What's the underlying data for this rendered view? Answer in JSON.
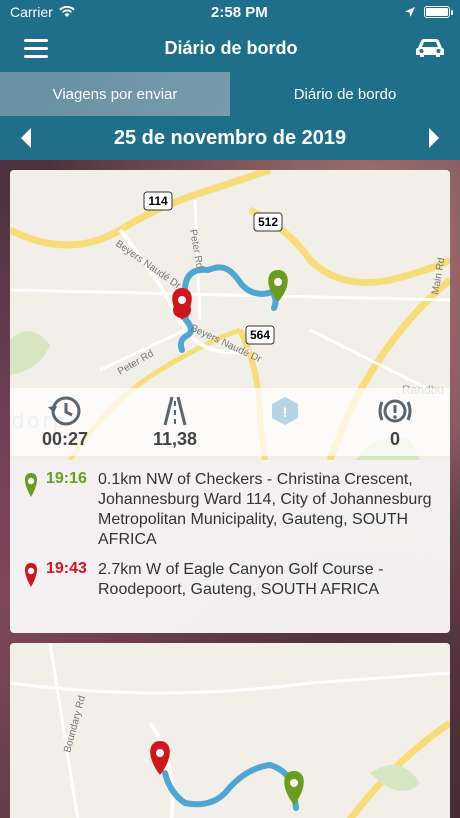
{
  "status_bar": {
    "carrier": "Carrier",
    "time": "2:58 PM"
  },
  "nav": {
    "title": "Diário de bordo"
  },
  "tabs": [
    {
      "label": "Viagens por enviar",
      "active": false
    },
    {
      "label": "Diário de bordo",
      "active": true
    }
  ],
  "date_nav": {
    "date": "25 de novembro de 2019"
  },
  "trip1": {
    "map_labels": {
      "road_114": "114",
      "road_512": "512",
      "road_564": "564",
      "peter_rd_1": "Peter Rd",
      "peter_rd_2": "Peter Rd",
      "beyers_naude": "Beyers Naudé Dr",
      "beyers_naude_2": "Beyers Naudé Dr",
      "main_rd": "Main Rd",
      "randburg": "Randbu",
      "dorp": "dorp"
    },
    "stats": {
      "duration": "00:27",
      "distance": "11,38",
      "harsh_events": "0"
    },
    "start": {
      "time": "19:16",
      "address": "0.1km NW of Checkers - Christina Crescent, Johannesburg Ward 114, City of Johannesburg Metropolitan Municipality, Gauteng, SOUTH AFRICA"
    },
    "end": {
      "time": "19:43",
      "address": "2.7km W of Eagle Canyon Golf Course - Roodepoort, Gauteng, SOUTH AFRICA"
    }
  },
  "trip2": {
    "map_labels": {
      "boundary_rd": "Boundary Rd"
    }
  },
  "colors": {
    "primary": "#1f6f8b",
    "start_pin": "#6a9c1e",
    "end_pin": "#d0161d",
    "route": "#4fa6d2"
  }
}
